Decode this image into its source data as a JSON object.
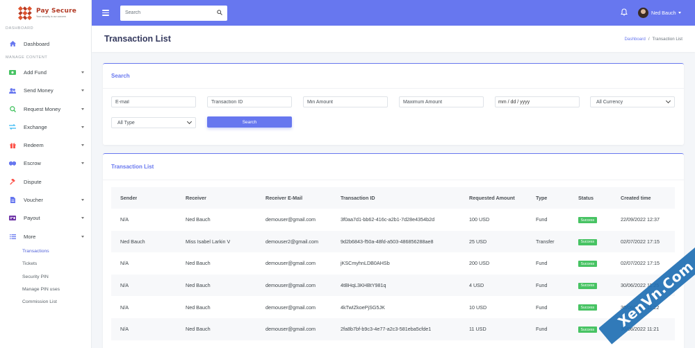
{
  "brand": {
    "name": "Pay Secure",
    "tagline": "Your security is our concern",
    "color": "#b23a25"
  },
  "sidebar": {
    "heading_dashboard": "DASHBOARD",
    "heading_manage": "MANAGE CONTENT",
    "dashboard": {
      "label": "Dashboard",
      "icon": "home-icon"
    },
    "items": [
      {
        "label": "Add Fund",
        "icon": "money-bill-icon",
        "color": "#47c363",
        "has_caret": true
      },
      {
        "label": "Send Money",
        "icon": "users-icon",
        "color": "#6777ef",
        "has_caret": true
      },
      {
        "label": "Request Money",
        "icon": "search-dollar-icon",
        "color": "#47c363",
        "has_caret": true
      },
      {
        "label": "Exchange",
        "icon": "exchange-icon",
        "color": "#3abaf4",
        "has_caret": true
      },
      {
        "label": "Redeem",
        "icon": "gift-icon",
        "color": "#fc544b",
        "has_caret": true
      },
      {
        "label": "Escrow",
        "icon": "handshake-icon",
        "color": "#6777ef",
        "has_caret": true
      },
      {
        "label": "Dispute",
        "icon": "gavel-icon",
        "color": "#fc544b",
        "has_caret": false
      },
      {
        "label": "Voucher",
        "icon": "file-icon",
        "color": "#6777ef",
        "has_caret": true
      },
      {
        "label": "Payout",
        "icon": "money-check-icon",
        "color": "#6b2fa5",
        "has_caret": true
      },
      {
        "label": "More",
        "icon": "list-icon",
        "color": "#6777ef",
        "has_caret": true
      }
    ],
    "sub_items": [
      {
        "label": "Transactions",
        "active": true
      },
      {
        "label": "Tickets",
        "active": false
      },
      {
        "label": "Security PIN",
        "active": false
      },
      {
        "label": "Manage PIN uses",
        "active": false
      },
      {
        "label": "Commission List",
        "active": false
      }
    ]
  },
  "topbar": {
    "search_placeholder": "Search",
    "user_name": "Ned Bauch",
    "bg": "#6777ef"
  },
  "page": {
    "title": "Transaction List",
    "breadcrumb": {
      "home": "Dashboard",
      "separator": "/",
      "current": "Transaction List"
    }
  },
  "search_card": {
    "title": "Search",
    "email_placeholder": "E-mail",
    "trx_placeholder": "Transaction ID",
    "min_placeholder": "Min Amount",
    "max_placeholder": "Maximum Amount",
    "date_placeholder": "mm / dd / yyyy",
    "currency_value": "All Currency",
    "type_value": "All Type",
    "button": "Search"
  },
  "list_card": {
    "title": "Transaction List",
    "columns": [
      "Sender",
      "Receiver",
      "Receiver E-Mail",
      "Transaction ID",
      "Requested Amount",
      "Type",
      "Status",
      "Created time"
    ],
    "rows": [
      [
        "N/A",
        "Ned Bauch",
        "demouser@gmail.com",
        "3f0aa7d1-bb62-416c-a2b1-7d28e4354b2d",
        "100 USD",
        "Fund",
        "Success",
        "22/09/2022 12:37"
      ],
      [
        "Ned Bauch",
        "Miss Isabel Larkin V",
        "demouser2@gmail.com",
        "9d2b6843-f50a-48fd-a503-486856288ae8",
        "25 USD",
        "Transfer",
        "Success",
        "02/07/2022 17:15"
      ],
      [
        "N/A",
        "Ned Bauch",
        "demouser@gmail.com",
        "jKSCmyhnLDB0AHSb",
        "200 USD",
        "Fund",
        "Success",
        "02/07/2022 17:15"
      ],
      [
        "N/A",
        "Ned Bauch",
        "demouser@gmail.com",
        "4tBHqL3KHBtY981q",
        "4 USD",
        "Fund",
        "Success",
        "30/06/2022 11:25"
      ],
      [
        "N/A",
        "Ned Bauch",
        "demouser@gmail.com",
        "4kTwIZkoePjSG5JK",
        "10 USD",
        "Fund",
        "Success",
        "30/06/2022 11:22"
      ],
      [
        "N/A",
        "Ned Bauch",
        "demouser@gmail.com",
        "2fa8b7bf-b9c3-4e77-a2c3-581eba5cfde1",
        "11 USD",
        "Fund",
        "Success",
        "30/06/2022 11:21"
      ]
    ]
  },
  "watermark": "XenVn.Com"
}
